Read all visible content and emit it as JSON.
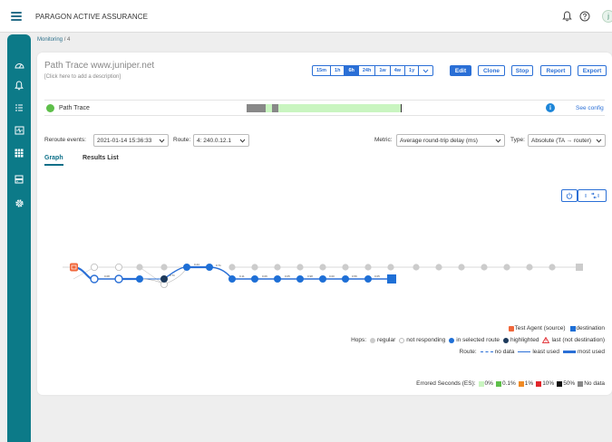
{
  "header": {
    "app_title": "PARAGON ACTIVE ASSURANCE",
    "avatar_initial": "j"
  },
  "sidebar": {
    "items": [
      {
        "name": "dashboard-icon"
      },
      {
        "name": "bell-icon"
      },
      {
        "name": "list-icon"
      },
      {
        "name": "monitor-icon"
      },
      {
        "name": "grid-icon"
      },
      {
        "name": "server-icon"
      },
      {
        "name": "gear-icon"
      }
    ]
  },
  "breadcrumb": {
    "root": "Monitoring",
    "separator": "/",
    "current": "4"
  },
  "page": {
    "title": "Path Trace www.juniper.net",
    "description": "[Click here to add a description]"
  },
  "toolbar": {
    "ranges": [
      "15m",
      "1h",
      "6h",
      "24h",
      "1w",
      "4w",
      "1y"
    ],
    "active_range": "6h",
    "edit": "Edit",
    "clone": "Clone",
    "stop": "Stop",
    "report": "Report",
    "export": "Export"
  },
  "trace": {
    "label": "Path Trace",
    "see_config": "See config",
    "info": "i"
  },
  "controls": {
    "reroute_label": "Reroute events:",
    "reroute_value": "2021-01-14 15:36:33",
    "route_label": "Route:",
    "route_value": "4: 240.0.12.1",
    "metric_label": "Metric:",
    "metric_value": "Average round-trip delay (ms)",
    "type_label": "Type:",
    "type_value": "Absolute (TA → router)"
  },
  "tabs": [
    {
      "label": "Graph",
      "active": true
    },
    {
      "label": "Results List",
      "active": false
    }
  ],
  "graph": {
    "edge_labels": [
      "0.08",
      "0.71",
      "0.44",
      "0.71",
      "0.11",
      "0.06",
      "0.05",
      "0.98",
      "0.00",
      "0.56",
      "0.05"
    ]
  },
  "legend": {
    "source": "Test Agent (source)",
    "destination": "destination",
    "hops_label": "Hops:",
    "hop_regular": "regular",
    "hop_not_responding": "not responding",
    "hop_selected": "in selected route",
    "hop_highlighted": "highlighted",
    "hop_last": "last (not destination)",
    "route_label": "Route:",
    "route_no_data": "no data",
    "route_least": "least used",
    "route_most": "most used",
    "es_label": "Errored Seconds (ES):",
    "es_items": [
      "0%",
      "0.1%",
      "1%",
      "10%",
      "50%",
      "No data"
    ]
  },
  "colors": {
    "accent": "#2a6fd6",
    "sidebar": "#0c7a88",
    "es_0": "#c9f5c0",
    "es_01": "#5ebf4a",
    "es_1": "#f08a24",
    "es_10": "#e0262b",
    "es_50": "#111111",
    "es_nodata": "#888888"
  }
}
